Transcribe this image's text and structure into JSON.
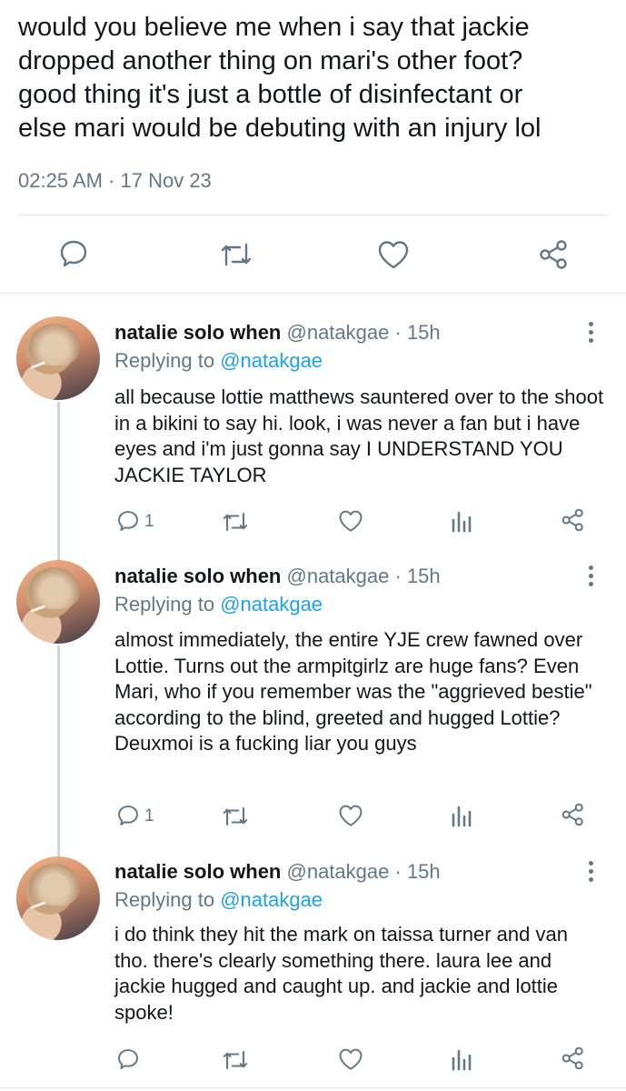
{
  "main_tweet": {
    "text": "would you believe me when i say that jackie\ndropped another thing on mari's other foot?\ngood thing it's just a bottle of disinfectant or\nelse mari would be debuting with an injury lol",
    "timestamp": "02:25 AM · 17 Nov 23",
    "actions": [
      "reply-icon",
      "retweet-icon",
      "like-icon",
      "share-icon"
    ]
  },
  "replies": [
    {
      "name": "natalie solo when",
      "handle": "@natakgae",
      "dot": "·",
      "time": "15h",
      "replying_prefix": "Replying to ",
      "replying_to": "@natakgae",
      "text": "all because lottie matthews sauntered over to the shoot in a bikini to say hi. look, i was never a fan but i have eyes and i'm just gonna say I UNDERSTAND YOU JACKIE TAYLOR",
      "reply_count": "1"
    },
    {
      "name": "natalie solo when",
      "handle": "@natakgae",
      "dot": "·",
      "time": "15h",
      "replying_prefix": "Replying to ",
      "replying_to": "@natakgae",
      "text": "almost immediately, the entire YJE crew fawned over Lottie. Turns out the armpitgirlz are huge fans? Even Mari, who if you remember was the \"aggrieved bestie\" according to the blind, greeted and hugged Lottie? Deuxmoi is a fucking liar you guys",
      "reply_count": "1"
    },
    {
      "name": "natalie solo when",
      "handle": "@natakgae",
      "dot": "·",
      "time": "15h",
      "replying_prefix": "Replying to ",
      "replying_to": "@natakgae",
      "text": "i do think they hit the mark on taissa turner and van tho. there's clearly something there. laura lee and jackie hugged and caught up. and jackie and lottie spoke!",
      "reply_count": ""
    }
  ],
  "colors": {
    "text": "#14171a",
    "secondary": "#657786",
    "link": "#1da1f2",
    "divider": "#e1e8ed"
  }
}
